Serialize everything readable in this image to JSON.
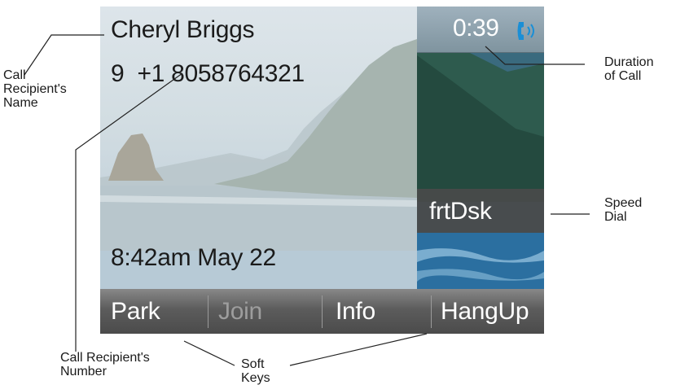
{
  "call": {
    "recipient_name": "Cheryl Briggs",
    "recipient_number": "9  +1 8058764321",
    "datetime": "8:42am May 22",
    "duration": "0:39"
  },
  "speed_dial": {
    "label": "frtDsk"
  },
  "softkeys": [
    {
      "label": "Park",
      "enabled": true
    },
    {
      "label": "Join",
      "enabled": false
    },
    {
      "label": "Info",
      "enabled": true
    },
    {
      "label": "HangUp",
      "enabled": true
    }
  ],
  "callouts": {
    "name": [
      "Call",
      "Recipient's",
      "Name"
    ],
    "number": [
      "Call Recipient's",
      "Number"
    ],
    "duration": [
      "Duration",
      "of Call"
    ],
    "speed_dial": [
      "Speed",
      "Dial"
    ],
    "soft_keys": [
      "Soft",
      "Keys"
    ]
  },
  "icons": {
    "call_status": "handset-icon"
  },
  "colors": {
    "softkey_bar": "#5c5c5c",
    "phone_icon": "#1a8fd6",
    "disabled_text": "#9d9d9d"
  }
}
